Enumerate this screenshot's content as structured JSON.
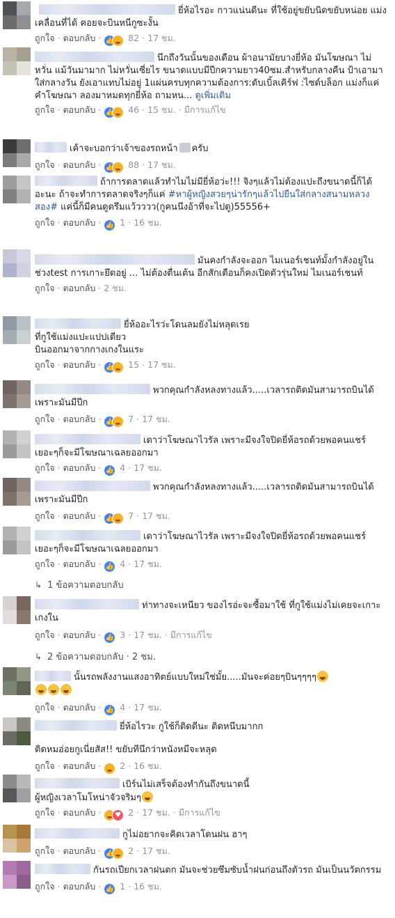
{
  "labels": {
    "like": "ถูกใจ",
    "reply": "ตอบกลับ",
    "sep": "·"
  },
  "colors": {
    "link": "#365899",
    "meta": "#90949c",
    "like": "#4080ff",
    "haha": "#f7b125",
    "love": "#f25268"
  },
  "comments": [
    {
      "text": "ยี่ห้อไรอะ กาวแน่นดีนะ ที่ใช้อยู่ขยับนิดขยับหน่อย แม่งเคลื่อนที่ได้ คอยจะบินหนีกูซะงั้น",
      "count": "82",
      "time": "17 ชม."
    },
    {
      "text": "นึกถึงวันนั้นของเดือน ผ้าอนามัยบางยี่ห้อ มันโฆษณา ไม่หวั่น แม้วันมามาก ไม่หวั่นเซี่ยไร ขนาดแบบมีปีกความยาว40ซม.สำหรับกลางคืน ป้าเอามาใส่กลางวัน ยังเอาแทบไม่อยู่ 1แผ่นครบทุกความต้องการ:ดับเบิ้ลเคิร์ฟ :ไซด์บล็อก แม่งก็แค่คำโฆษณา ลองมาหมดทุกยี่ห้อ ถามหน...",
      "seemore": "ดูเพิ่มเติม",
      "count": "46",
      "time": "15 ชม.",
      "edited": "มีการแก้ไข"
    },
    {
      "text_a": "เค้าจะบอกว่าเจ้าของรถหน้า",
      "text_b": "ครับ",
      "count": "88",
      "time": "17 ชม."
    },
    {
      "text_a": "ถ้าการตลาดแล้วทำไมไม่มียี่ห้อว่ะ!!! จิงๆแล้วไม่ต้องแปะถึงขนาดนี้ก็ได้อะนะ ถ้าจะทำการตลาดจริงๆก็แค่ ",
      "hashtag": "#หาผู้หญิงสวยๆน่ารักๆแล้วไปยืนใส่กลางสนามหลวงสอง#",
      "text_b": " แค่นี้ก็มีคนดูตรึมแว้วววว(กูคนนึงอ้าที่จะไปดู)55556+",
      "count": "1",
      "time": "16 ชม."
    },
    {
      "text": "มันคงกำลังจะออก ไมเนอร์เชนท์มั้งกำลังอยู่ในช่วงtest การเกาะยึดอยู่ ... ไม่ต้องตื่นเต้น อีกสักเดือนก็คงเปิดตัวรุ่นใหม่ ไมเนอร์เชนท์",
      "time": "2 ชม."
    },
    {
      "line1": "ยี่ห้ออะไรว่ะโดนลมยังไม่หลุดเรย",
      "line2": "ที่กูใช้แม่งแปะแปปเดียว",
      "line3": "บินออกมาจากกางเกงในแระ",
      "count": "15",
      "time": "17 ชม."
    },
    {
      "text": "พวกคุณกำลังหลงทางแล้ว.....เวลารถติดมันสามารถบินได้เพราะมันมีปีก",
      "count": "7",
      "time": "17 ชม."
    },
    {
      "text": "เดาว่าโฆษณาไวรัล เพราะมีจงใจปิดยี่ห้อรถด้วยพอคนแชร์เยอะๆก็จะมีโฆษณาเฉลยออกมา",
      "count": "4",
      "time": "17 ชม."
    },
    {
      "text": "พวกคุณกำลังหลงทางแล้ว.....เวลารถติดมันสามารถบินได้เพราะมันมีปีก",
      "count": "7",
      "time": "17 ชม."
    },
    {
      "text": "เดาว่าโฆษณาไวรัล เพราะมีจงใจปิดยี่ห้อรถด้วยพอคนแชร์เยอะๆก็จะมีโฆษณาเฉลยออกมา",
      "count": "4",
      "time": "17 ชม.",
      "replies": "1 ข้อความตอบกลับ"
    },
    {
      "text": "ท่าทางจะเหนียว ของไรอ่ะจะซื้อมาใช้ ที่กูใช้แม่งไม่เคยจะเกาะเกงใน",
      "count": "3",
      "time": "17 ชม.",
      "edited": "มีการแก้ไข",
      "replies": "2 ข้อความตอบกลับ · 2 ชม."
    },
    {
      "text": "นั้นรถพลังงานแสงอาทิตย์แบบใหม่ใช่มั้ย.....มันจะค่อยๆบินๆๆๆๆ",
      "count": "4",
      "time": "17 ชม."
    },
    {
      "line1": "ยี่ห้อไรวะ กูใช้ก็ติดดีนะ ติดหนึบมากก",
      "line2": "ติดหมอ่อยกูเนี่ยสัส!! ขยับทีนึกว่าหนังหมีจะหลุด",
      "count": "2",
      "time": "16 ชม."
    },
    {
      "line1": "เบิร์นไม่เสร็จต้องทำกันถึงขนาดนี้",
      "line2": "ผู้หญิงเวลาโมโหน่าจัวจริมๆ",
      "count": "2",
      "time": "17 ชม.",
      "edited": "มีการแก้ไข"
    },
    {
      "text": "กูไม่อยากจะคิดเวลาโดนฝน ฮาๆ",
      "count": "2",
      "time": "17 ชม."
    },
    {
      "text": "กันรถเปียกเวลาฝนตก มันจะช่วยซึมซับน้ำฝนก่อนถึงตัวรถ มันเป็นนวัตกรรม",
      "count": "1",
      "time": "16 ชม."
    }
  ]
}
